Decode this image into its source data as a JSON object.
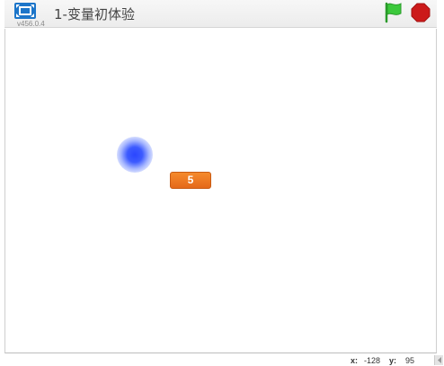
{
  "header": {
    "title": "1-变量初体验",
    "version": "v456.0.4",
    "fullscreen_icon": "fullscreen-icon",
    "green_flag_icon": "green-flag-icon",
    "stop_icon": "stop-sign-icon"
  },
  "stage": {
    "variable_monitor": {
      "value": "5"
    },
    "sprite_name": "blue-glow-ball"
  },
  "footer": {
    "x_label": "x:",
    "x_value": "-128",
    "y_label": "y:",
    "y_value": "95"
  },
  "colors": {
    "monitor_orange": "#f07a22",
    "flag_green": "#3cc93c",
    "stop_red": "#cc1a1a",
    "fullscreen_blue": "#1c75c9",
    "sprite_blue": "#2a46ff"
  }
}
